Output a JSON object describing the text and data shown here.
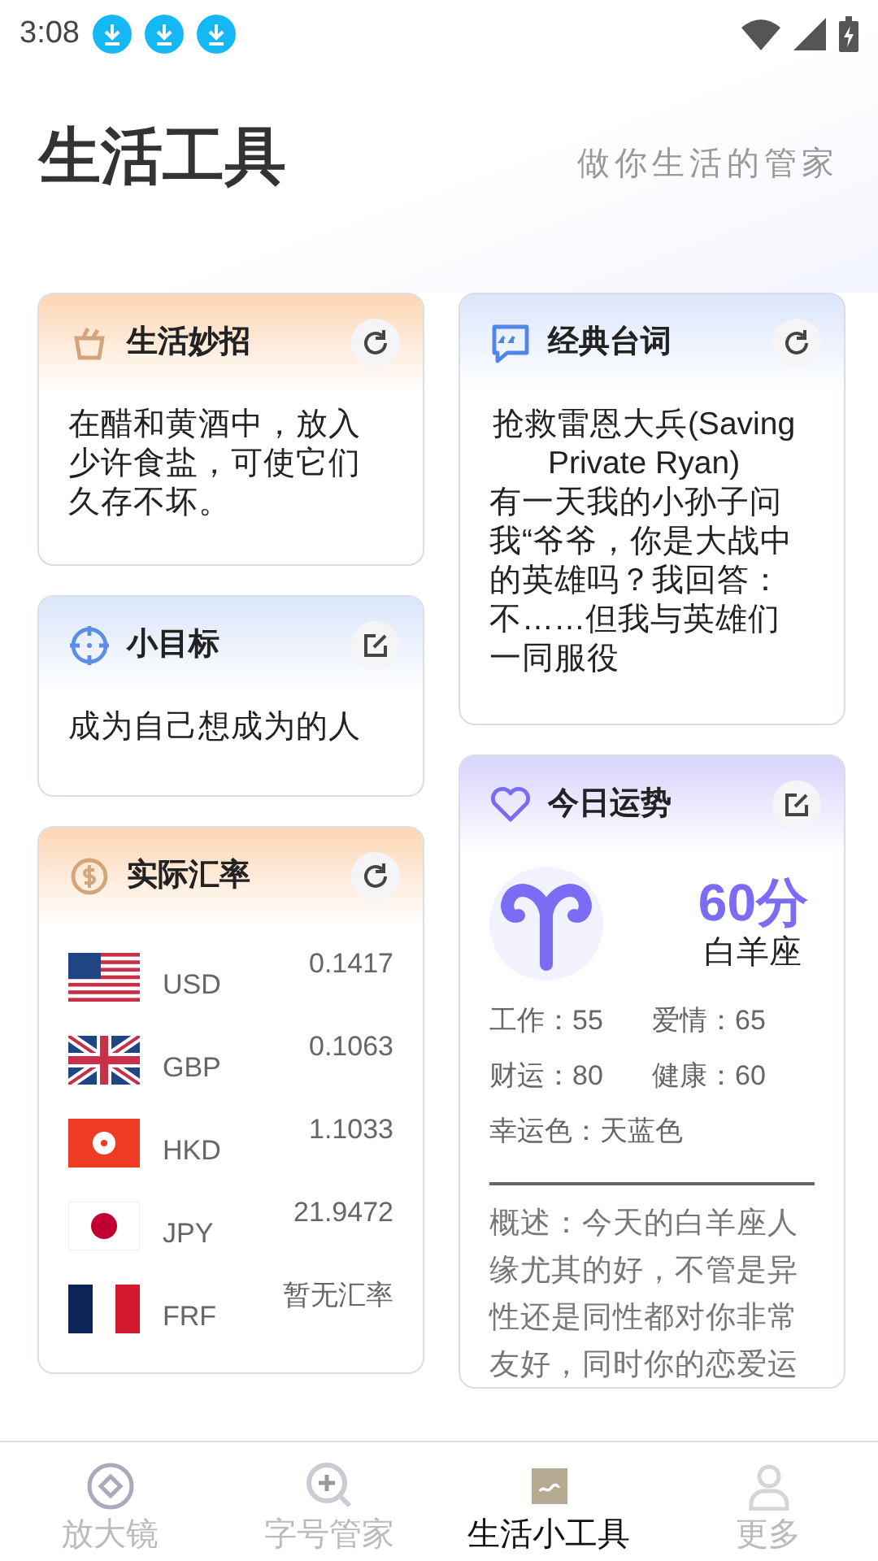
{
  "status_bar": {
    "time": "3:08"
  },
  "header": {
    "title": "生活工具",
    "slogan": "做你生活的管家"
  },
  "left_cards": [
    {
      "kind": "tip",
      "title": "生活妙招",
      "text": "在醋和黄酒中，放入少许食盐，可使它们久存不坏。"
    },
    {
      "kind": "goal",
      "title": "小目标",
      "text": "成为自己想成为的人"
    },
    {
      "kind": "rates",
      "title": "实际汇率",
      "rates": [
        {
          "kind": "us",
          "currency": "USD",
          "rate": "0.1417"
        },
        {
          "kind": "gb",
          "currency": "GBP",
          "rate": "0.1063"
        },
        {
          "kind": "hk",
          "currency": "HKD",
          "rate": "1.1033"
        },
        {
          "kind": "jp",
          "currency": "JPY",
          "rate": "21.9472"
        },
        {
          "kind": "fr",
          "currency": "FRF",
          "rate": "暂无汇率"
        }
      ]
    }
  ],
  "right_cards": [
    {
      "kind": "quote",
      "title": "经典台词",
      "movie": "抢救雷恩大兵(Saving Private Ryan)",
      "text": "有一天我的小孙子问我“爷爷，你是大战中的英雄吗？我回答：不……但我与英雄们一同服役"
    },
    {
      "kind": "fortune",
      "title": "今日运势",
      "score": "60分",
      "sign": "白羊座",
      "stats": [
        "工作：55",
        "爱情：65",
        "财运：80",
        "健康：60"
      ],
      "lucky_color": "幸运色：天蓝色",
      "summary": "概述：今天的白羊座人缘尤其的好，不管是异性还是同性都对你非常友好，同时你的恋爱运"
    }
  ],
  "tabs": [
    {
      "label": "放大镜",
      "selected": false
    },
    {
      "label": "字号管家",
      "selected": false
    },
    {
      "label": "生活小工具",
      "selected": true
    },
    {
      "label": "更多",
      "selected": false
    }
  ]
}
